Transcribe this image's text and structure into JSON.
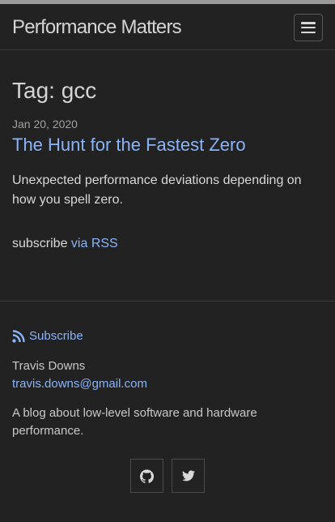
{
  "header": {
    "site_title": "Performance Matters",
    "nav_toggle_icon": "hamburger-icon"
  },
  "page": {
    "heading": "Tag: gcc"
  },
  "post": {
    "date": "Jan 20, 2020",
    "title": "The Hunt for the Fastest Zero",
    "excerpt": "Unexpected performance deviations depending on how you spell zero."
  },
  "subscribe": {
    "prefix": "subscribe ",
    "link_label": "via RSS"
  },
  "footer": {
    "rss_icon": "rss-icon",
    "rss_label": "Subscribe",
    "author_name": "Travis Downs",
    "author_email": "travis.downs@gmail.com",
    "description": "A blog about low-level software and hardware performance.",
    "social": [
      {
        "icon": "github-icon"
      },
      {
        "icon": "twitter-icon"
      }
    ]
  },
  "colors": {
    "background": "#222222",
    "link": "#8ab4f8",
    "text": "#d8d8d8"
  }
}
